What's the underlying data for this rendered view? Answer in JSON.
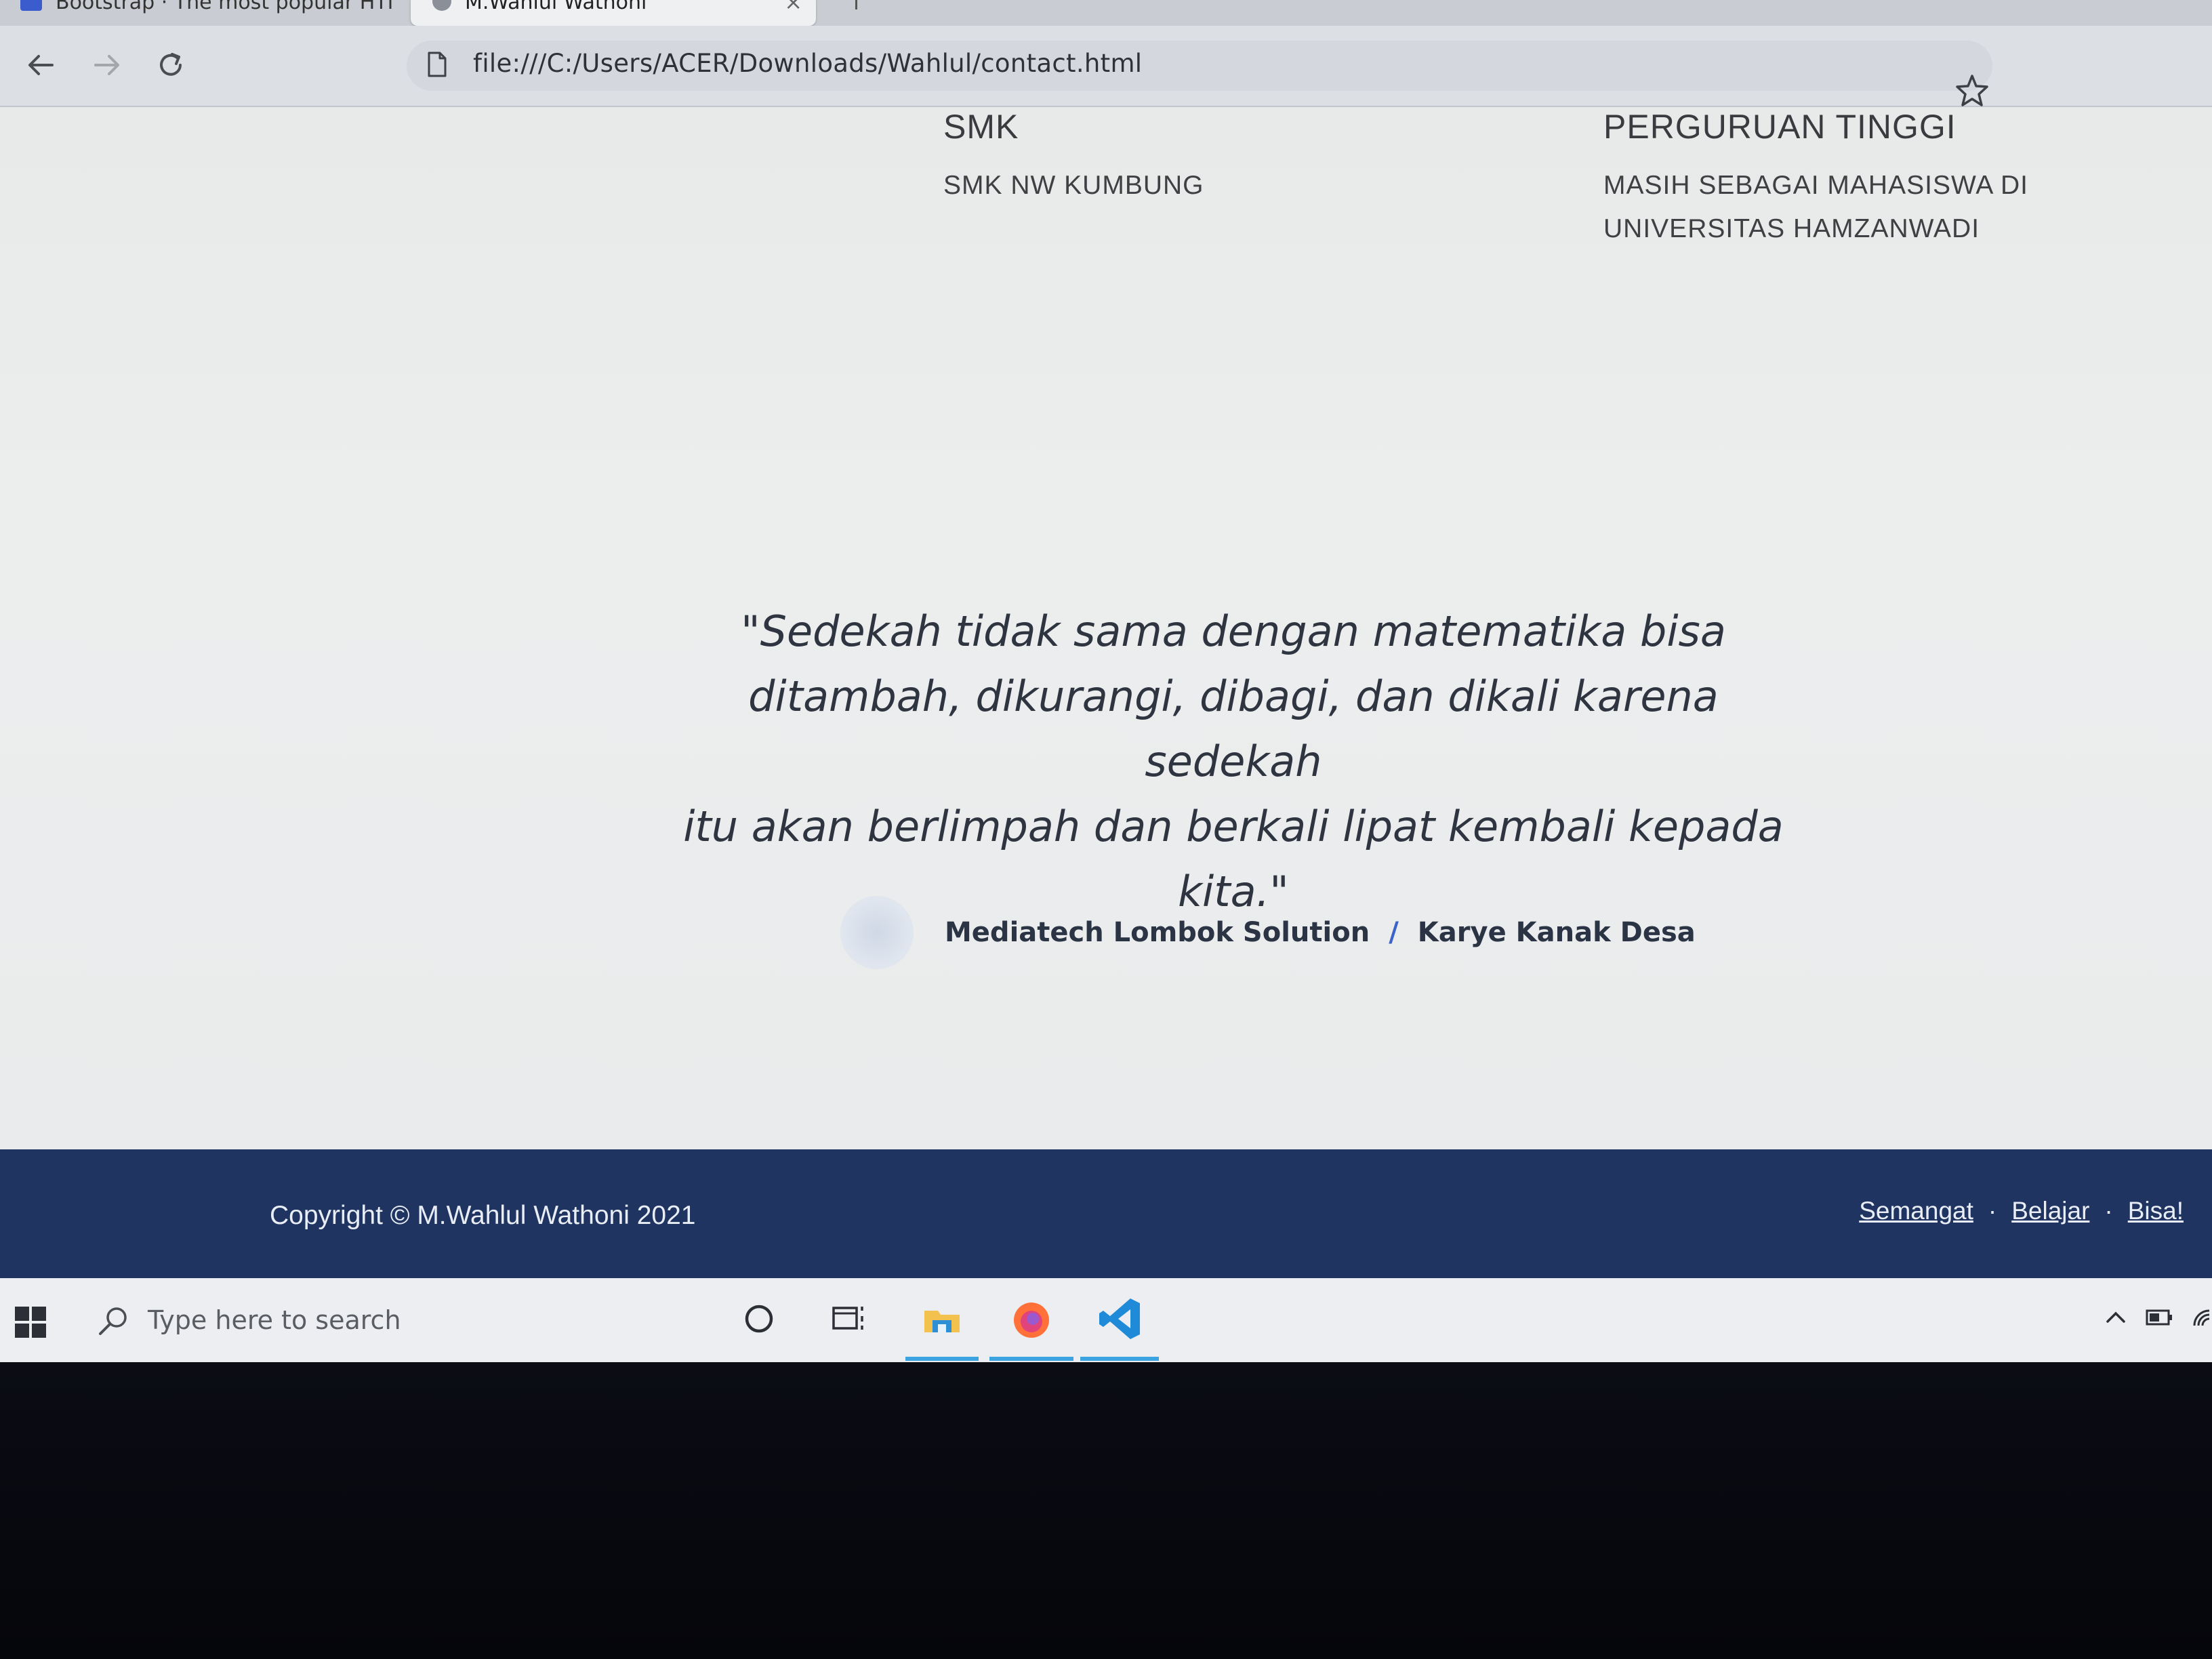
{
  "browser": {
    "inactive_tab_title": "Bootstrap · The most popular HTML",
    "active_tab_title": "M.Wahlul Wathoni",
    "tab_close": "×",
    "back": "←",
    "forward": "→",
    "reload": "↻",
    "url": "file:///C:/Users/ACER/Downloads/Wahlul/contact.html"
  },
  "education": {
    "smk_heading": "SMK",
    "smk_school": "SMK NW KUMBUNG",
    "pt_heading": "PERGURUAN TINGGI",
    "pt_line1": "MASIH SEBAGAI MAHASISWA DI",
    "pt_line2": "UNIVERSITAS HAMZANWADI"
  },
  "testimonial": {
    "quote_line1": "\"Sedekah tidak sama dengan matematika bisa",
    "quote_line2": "ditambah, dikurangi, dibagi, dan dikali karena sedekah",
    "quote_line3": "itu akan berlimpah dan berkali lipat kembali kepada",
    "quote_line4": "kita.\"",
    "author_name": "Mediatech Lombok Solution",
    "separator": "/",
    "author_org": "Karye Kanak Desa"
  },
  "footer": {
    "copyright": "Copyright © M.Wahlul Wathoni 2021",
    "links": [
      "Semangat",
      "Belajar",
      "Bisa!"
    ],
    "dot": "·",
    "background": "#1f3460"
  },
  "taskbar": {
    "search_placeholder": "Type here to search",
    "accent": "#3aa3e0"
  }
}
